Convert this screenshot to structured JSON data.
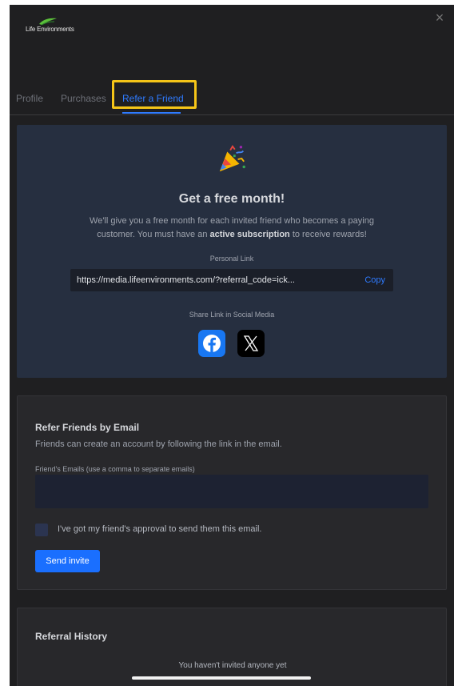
{
  "brand": {
    "name": "Life Environments"
  },
  "header": {
    "close_label": "×"
  },
  "tabs": [
    {
      "label": "Profile"
    },
    {
      "label": "Purchases"
    },
    {
      "label": "Refer a Friend"
    }
  ],
  "referral": {
    "title": "Get a free month!",
    "description_part1": "We'll give you a free month for each invited friend who becomes a paying customer. You must have an ",
    "description_bold": "active subscription",
    "description_part2": " to receive rewards!",
    "personal_link_label": "Personal Link",
    "personal_link_value": "https://media.lifeenvironments.com/?referral_code=ick...",
    "copy_label": "Copy",
    "share_label": "Share Link in Social Media",
    "share_icons": [
      "facebook-icon",
      "x-icon"
    ]
  },
  "email_refer": {
    "title": "Refer Friends by Email",
    "subtitle": "Friends can create an account by following the link in the email.",
    "emails_label": "Friend's Emails (use a comma to separate emails)",
    "emails_value": "",
    "approval_label": "I've got my friend's approval to send them this email.",
    "approval_checked": false,
    "send_label": "Send invite"
  },
  "history": {
    "title": "Referral History",
    "empty_text": "You haven't invited anyone yet"
  },
  "colors": {
    "accent": "#2f7bff",
    "highlight": "#f5c518",
    "facebook": "#1877f2"
  }
}
